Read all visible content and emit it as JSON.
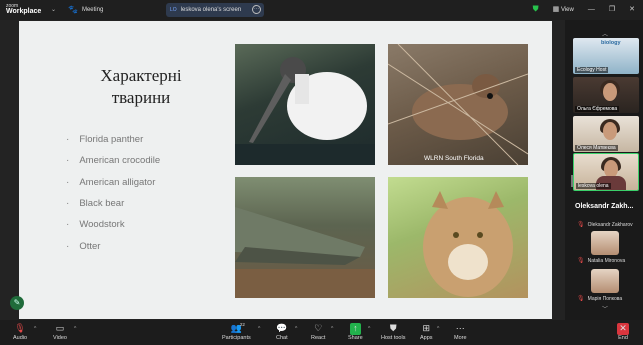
{
  "topbar": {
    "logo_small": "zoom",
    "logo_big": "Workplace",
    "meeting_label": "Meeting",
    "share_initials": "LO",
    "share_label": "leskova olena's screen",
    "view_label": "View"
  },
  "slide": {
    "title_line1": "Характерні",
    "title_line2": "тварини",
    "animals": [
      "Florida panther",
      "American crocodile",
      "American alligator",
      "Black bear",
      "Woodstork",
      "Otter"
    ],
    "photo_caption": "WLRN South Florida"
  },
  "participants": {
    "tiles": [
      {
        "label": "Ecology Host",
        "logo_text": "biology"
      },
      {
        "label": "Ольга Єфремова"
      },
      {
        "label": "Олеся Матвеєва"
      },
      {
        "label": "leskova olena"
      }
    ],
    "active_name": "Oleksandr Zakh...",
    "list": [
      {
        "name": "Oleksandr Zakharov"
      },
      {
        "name": "Natalia Mironova"
      },
      {
        "name": "Марія Попкова"
      }
    ]
  },
  "toolbar": {
    "audio": "Audio",
    "video": "Video",
    "participants": "Participants",
    "participants_count": "22",
    "chat": "Chat",
    "react": "React",
    "share": "Share",
    "host_tools": "Host tools",
    "apps": "Apps",
    "more": "More",
    "end": "End"
  },
  "colors": {
    "accent_green": "#22b24c",
    "end_red": "#d9363e",
    "active_border": "#3bd06a"
  }
}
